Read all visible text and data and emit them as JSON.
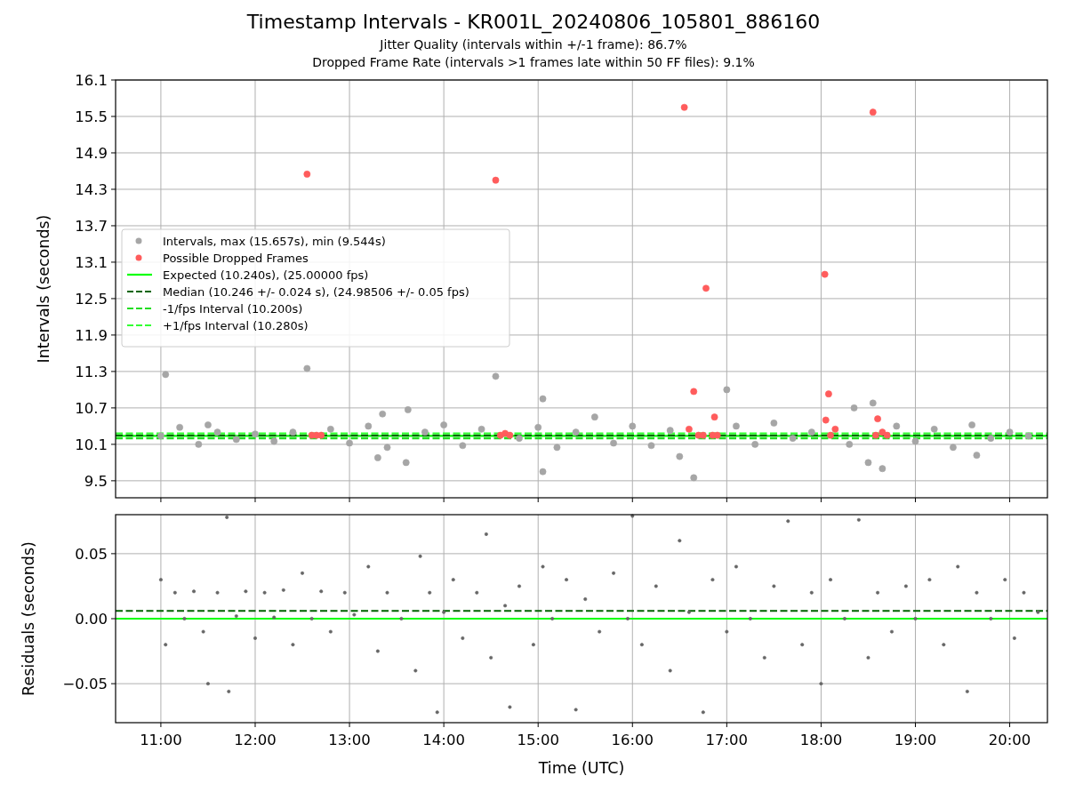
{
  "figure": {
    "title": "Timestamp Intervals - KR001L_20240806_105801_886160",
    "subtitles": [
      "Jitter Quality (intervals within +/-1 frame): 86.7%",
      "Dropped Frame Rate (intervals >1 frames late within 50 FF files): 9.1%"
    ]
  },
  "charts": [
    {
      "chart_data": {
        "type": "scatter",
        "ylabel": "Intervals (seconds)",
        "xlim": [
          10.52,
          20.4
        ],
        "ylim": [
          9.22,
          16.1
        ],
        "grid": true,
        "legend": true,
        "yticks": [
          9.5,
          10.1,
          10.7,
          11.3,
          11.9,
          12.5,
          13.1,
          13.7,
          14.3,
          14.9,
          15.5,
          16.1
        ],
        "series": [
          {
            "name": "Intervals, max (15.657s), min (9.544s)",
            "color": "#a6a6a6",
            "x": [
              11.0,
              11.05,
              11.2,
              11.4,
              11.5,
              11.6,
              11.8,
              12.0,
              12.2,
              12.4,
              12.55,
              12.8,
              13.0,
              13.2,
              13.3,
              13.35,
              13.4,
              13.6,
              13.62,
              13.8,
              14.0,
              14.2,
              14.4,
              14.55,
              14.8,
              15.0,
              15.05,
              15.05,
              15.2,
              15.4,
              15.6,
              15.8,
              16.0,
              16.2,
              16.4,
              16.5,
              16.65,
              17.0,
              17.1,
              17.3,
              17.5,
              17.7,
              17.9,
              18.3,
              18.35,
              18.5,
              18.55,
              18.65,
              18.8,
              19.0,
              19.2,
              19.4,
              19.6,
              19.65,
              19.8,
              20.0,
              20.2
            ],
            "values": [
              10.24,
              11.25,
              10.38,
              10.1,
              10.42,
              10.3,
              10.18,
              10.27,
              10.15,
              10.3,
              11.35,
              10.35,
              10.12,
              10.4,
              9.88,
              10.6,
              10.05,
              9.8,
              10.67,
              10.3,
              10.42,
              10.08,
              10.35,
              11.22,
              10.2,
              10.38,
              10.85,
              9.65,
              10.05,
              10.3,
              10.55,
              10.12,
              10.4,
              10.08,
              10.33,
              9.9,
              9.55,
              11.0,
              10.4,
              10.1,
              10.45,
              10.2,
              10.3,
              10.1,
              10.7,
              9.8,
              10.78,
              9.7,
              10.4,
              10.15,
              10.35,
              10.05,
              10.42,
              9.92,
              10.2,
              10.3,
              10.24
            ]
          },
          {
            "name": "Possible Dropped Frames",
            "color": "#ff5c5c",
            "x": [
              12.55,
              12.6,
              12.65,
              12.7,
              14.55,
              14.6,
              14.65,
              14.7,
              16.55,
              16.6,
              16.65,
              16.7,
              16.75,
              16.78,
              16.85,
              16.87,
              16.9,
              18.04,
              18.05,
              18.08,
              18.1,
              18.15,
              18.55,
              18.58,
              18.6,
              18.65,
              18.7
            ],
            "values": [
              14.55,
              10.25,
              10.25,
              10.25,
              14.45,
              10.25,
              10.28,
              10.25,
              15.65,
              10.35,
              10.97,
              10.25,
              10.25,
              12.67,
              10.25,
              10.55,
              10.25,
              12.9,
              10.5,
              10.93,
              10.25,
              10.35,
              15.57,
              10.25,
              10.52,
              10.3,
              10.25
            ]
          }
        ],
        "ref_lines": [
          {
            "axis": "y",
            "value": 10.24,
            "label": "Expected (10.240s), (25.00000 fps)",
            "color": "#00ff00"
          },
          {
            "axis": "y",
            "value": 10.246,
            "label": "Median (10.246 +/- 0.024 s), (24.98506 +/- 0.05 fps)",
            "color": "#006400"
          },
          {
            "axis": "y",
            "value": 10.2,
            "label": "-1/fps Interval (10.200s)",
            "color": "#22dd22"
          },
          {
            "axis": "y",
            "value": 10.28,
            "label": "+1/fps Interval (10.280s)",
            "color": "#33ff33"
          }
        ]
      }
    },
    {
      "chart_data": {
        "type": "scatter",
        "xlabel": "Time (UTC)",
        "ylabel": "Residuals (seconds)",
        "xlim": [
          10.52,
          20.4
        ],
        "ylim": [
          -0.08,
          0.08
        ],
        "grid": true,
        "xticks": [
          {
            "value": 11,
            "label": "11:00"
          },
          {
            "value": 12,
            "label": "12:00"
          },
          {
            "value": 13,
            "label": "13:00"
          },
          {
            "value": 14,
            "label": "14:00"
          },
          {
            "value": 15,
            "label": "15:00"
          },
          {
            "value": 16,
            "label": "16:00"
          },
          {
            "value": 17,
            "label": "17:00"
          },
          {
            "value": 18,
            "label": "18:00"
          },
          {
            "value": 19,
            "label": "19:00"
          },
          {
            "value": 20,
            "label": "20:00"
          }
        ],
        "yticks": [
          {
            "value": -0.05,
            "label": "−0.05"
          },
          {
            "value": 0,
            "label": "0.00"
          },
          {
            "value": 0.05,
            "label": "0.05"
          }
        ],
        "series": [
          {
            "color": "#666666",
            "x": [
              11.0,
              11.05,
              11.15,
              11.25,
              11.35,
              11.45,
              11.5,
              11.6,
              11.7,
              11.72,
              11.8,
              11.9,
              12.0,
              12.1,
              12.2,
              12.3,
              12.4,
              12.5,
              12.6,
              12.7,
              12.8,
              12.95,
              13.05,
              13.2,
              13.3,
              13.4,
              13.55,
              13.7,
              13.75,
              13.85,
              13.93,
              14.0,
              14.1,
              14.2,
              14.35,
              14.45,
              14.5,
              14.65,
              14.7,
              14.8,
              14.95,
              15.05,
              15.15,
              15.3,
              15.4,
              15.5,
              15.65,
              15.8,
              15.95,
              16.0,
              16.1,
              16.25,
              16.4,
              16.5,
              16.6,
              16.75,
              16.85,
              17.0,
              17.1,
              17.25,
              17.4,
              17.5,
              17.65,
              17.8,
              17.9,
              18.0,
              18.1,
              18.25,
              18.4,
              18.5,
              18.6,
              18.75,
              18.9,
              19.0,
              19.15,
              19.3,
              19.45,
              19.55,
              19.65,
              19.8,
              19.95,
              20.05,
              20.15,
              20.3
            ],
            "values": [
              0.03,
              -0.02,
              0.02,
              0.0,
              0.021,
              -0.01,
              -0.05,
              0.02,
              0.078,
              -0.056,
              0.002,
              0.021,
              -0.015,
              0.02,
              0.001,
              0.022,
              -0.02,
              0.035,
              0.0,
              0.021,
              -0.01,
              0.02,
              0.003,
              0.04,
              -0.025,
              0.02,
              0.0,
              -0.04,
              0.048,
              0.02,
              -0.072,
              0.005,
              0.03,
              -0.015,
              0.02,
              0.065,
              -0.03,
              0.01,
              -0.068,
              0.025,
              -0.02,
              0.04,
              0.0,
              0.03,
              -0.07,
              0.015,
              -0.01,
              0.035,
              0.0,
              0.079,
              -0.02,
              0.025,
              -0.04,
              0.06,
              0.005,
              -0.072,
              0.03,
              -0.01,
              0.04,
              0.0,
              -0.03,
              0.025,
              0.075,
              -0.02,
              0.02,
              -0.05,
              0.03,
              0.0,
              0.076,
              -0.03,
              0.02,
              -0.01,
              0.025,
              0.0,
              0.03,
              -0.02,
              0.04,
              -0.056,
              0.02,
              0.0,
              0.03,
              -0.015,
              0.02,
              0.005
            ]
          }
        ],
        "ref_lines": [
          {
            "axis": "y",
            "value": 0.0,
            "color": "#00ff00"
          },
          {
            "axis": "y",
            "value": 0.006,
            "color": "#006400"
          }
        ]
      }
    }
  ]
}
